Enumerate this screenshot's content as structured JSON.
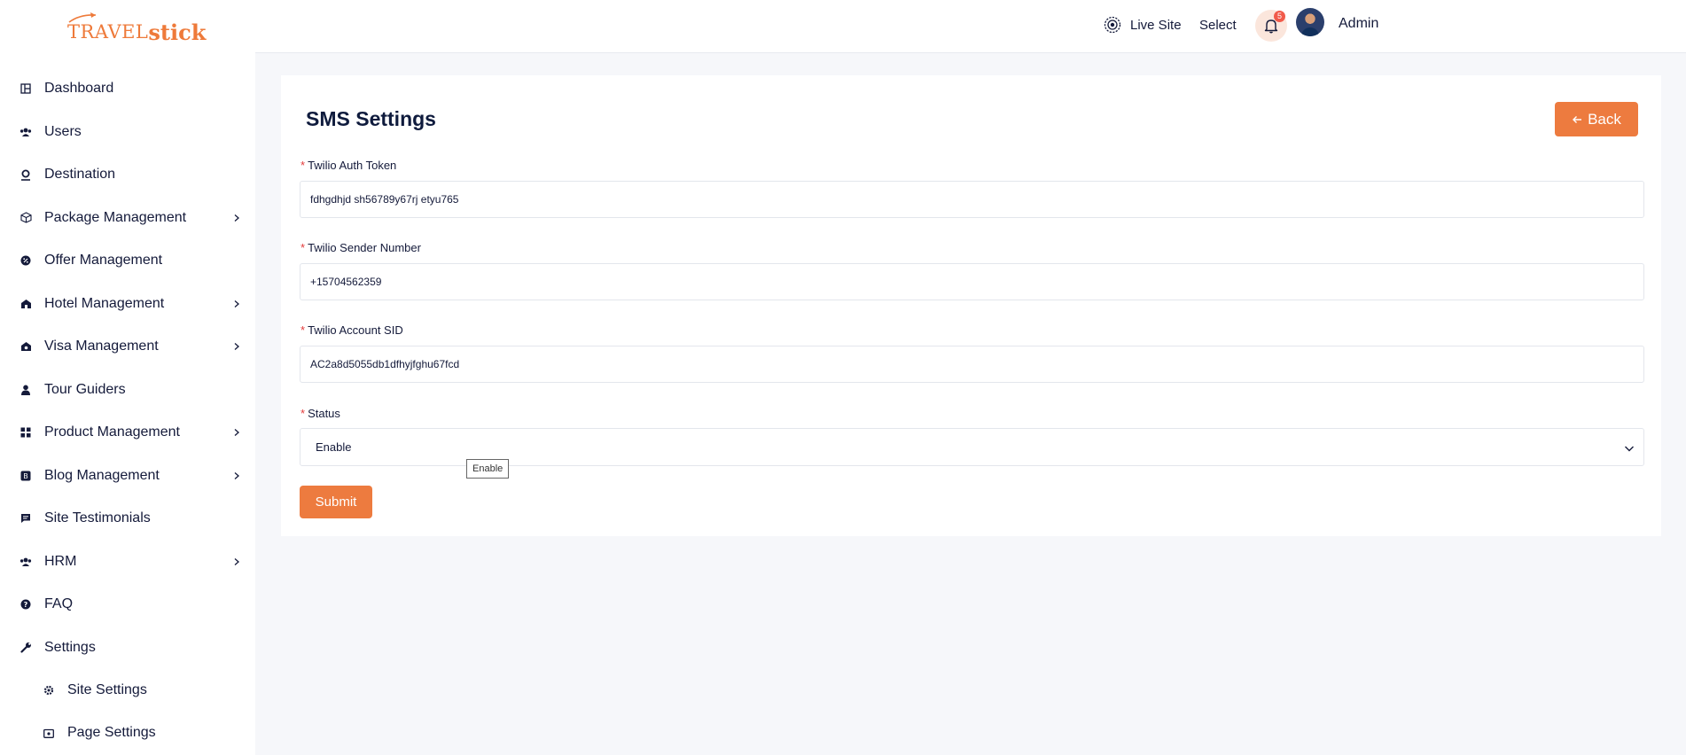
{
  "brand": {
    "logo_part1": "TRAVEL",
    "logo_part2": "stick"
  },
  "sidebar": {
    "items": [
      {
        "label": "Dashboard",
        "icon": "dashboard-icon",
        "has_submenu": false
      },
      {
        "label": "Users",
        "icon": "users-icon",
        "has_submenu": false
      },
      {
        "label": "Destination",
        "icon": "map-pin-icon",
        "has_submenu": false
      },
      {
        "label": "Package Management",
        "icon": "box-icon",
        "has_submenu": true
      },
      {
        "label": "Offer Management",
        "icon": "offer-badge-icon",
        "has_submenu": false
      },
      {
        "label": "Hotel Management",
        "icon": "hotel-icon",
        "has_submenu": true
      },
      {
        "label": "Visa Management",
        "icon": "visa-icon",
        "has_submenu": true
      },
      {
        "label": "Tour Guiders",
        "icon": "guide-icon",
        "has_submenu": false
      },
      {
        "label": "Product Management",
        "icon": "grid-icon",
        "has_submenu": true
      },
      {
        "label": "Blog Management",
        "icon": "blog-icon",
        "has_submenu": true
      },
      {
        "label": "Site Testimonials",
        "icon": "comment-icon",
        "has_submenu": false
      },
      {
        "label": "HRM",
        "icon": "team-icon",
        "has_submenu": true
      },
      {
        "label": "FAQ",
        "icon": "question-icon",
        "has_submenu": false
      },
      {
        "label": "Settings",
        "icon": "wrench-icon",
        "has_submenu": false
      }
    ],
    "subitems": [
      {
        "label": "Site Settings",
        "icon": "gear-icon"
      },
      {
        "label": "Page Settings",
        "icon": "page-icon"
      }
    ]
  },
  "header": {
    "live_site": "Live Site",
    "select": "Select",
    "notification_count": "5",
    "user_name": "Admin"
  },
  "main": {
    "title": "SMS Settings",
    "back_label": "Back",
    "fields": {
      "auth_token": {
        "label": "Twilio Auth Token",
        "value": "fdhgdhjd sh56789y67rj etyu765"
      },
      "sender_number": {
        "label": "Twilio Sender Number",
        "value": "+15704562359"
      },
      "account_sid": {
        "label": "Twilio Account SID",
        "value": "AC2a8d5055db1dfhyjfghu67fcd"
      },
      "status": {
        "label": "Status",
        "value": "Enable",
        "tooltip": "Enable"
      }
    },
    "submit_label": "Submit"
  },
  "colors": {
    "accent": "#ed7b3f",
    "required": "#e33b3b",
    "text": "#0f1b3d",
    "background": "#f6f7fa"
  }
}
